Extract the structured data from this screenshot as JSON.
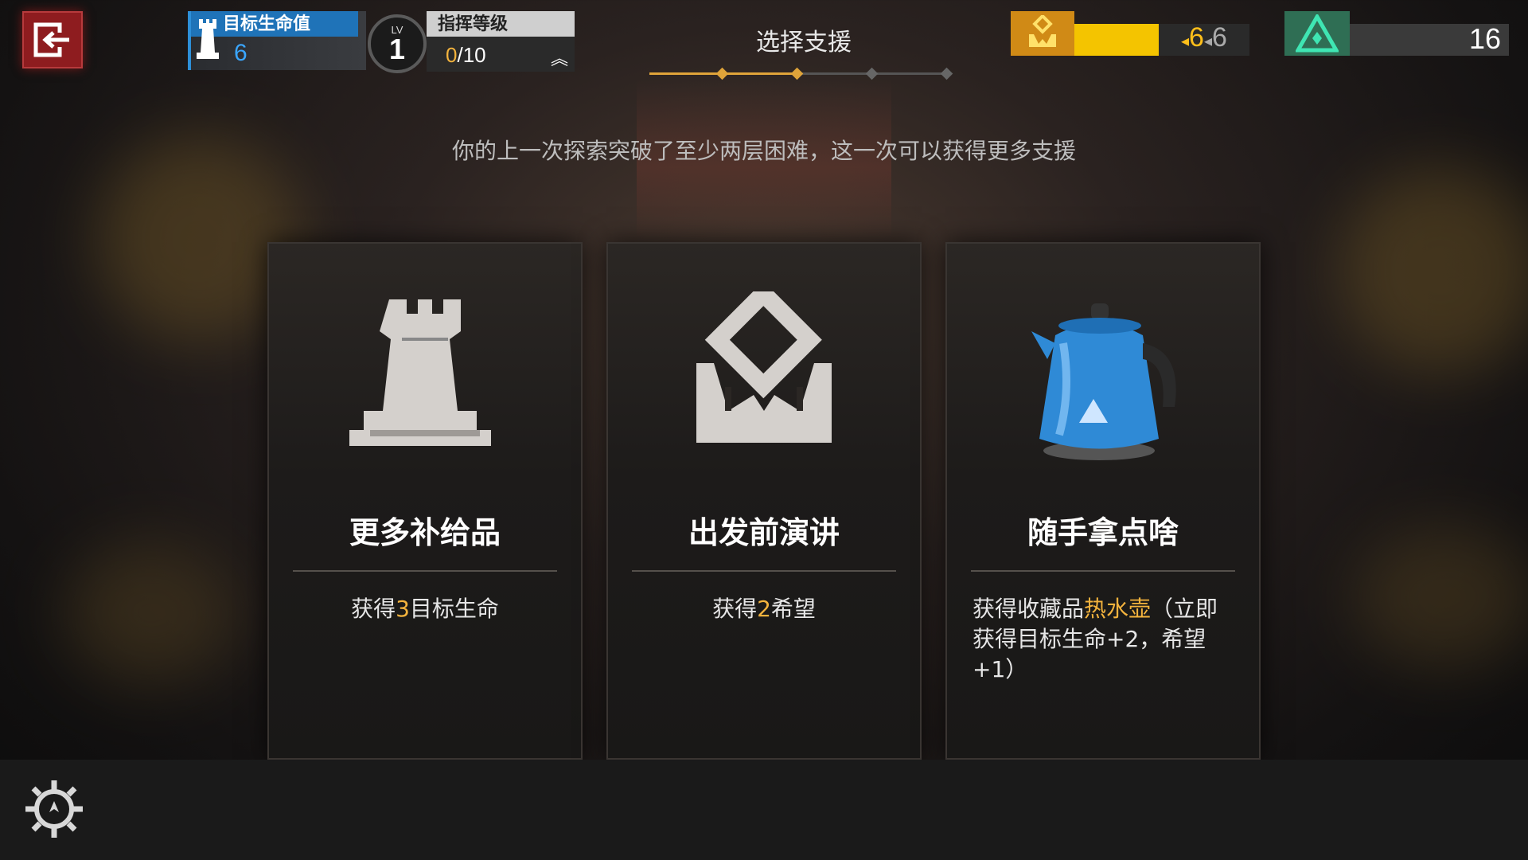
{
  "header": {
    "target_life_label": "目标生命值",
    "target_life_value": "6",
    "level_prefix": "LV",
    "level_value": "1",
    "command_label": "指挥等级",
    "command_progress_current": "0",
    "command_progress_max": "/10",
    "step_title": "选择支援",
    "steps_total": 4,
    "steps_done": 2,
    "hope_value": "6",
    "hope_max": "6",
    "hope_fill_fraction": 0.48,
    "token_value": "16"
  },
  "notice": "你的上一次探索突破了至少两层困难，这一次可以获得更多支援",
  "cards": [
    {
      "title": "更多补给品",
      "desc_prefix": "获得",
      "desc_highlight": "3",
      "desc_suffix": "目标生命",
      "icon": "rook-icon"
    },
    {
      "title": "出发前演讲",
      "desc_prefix": "获得",
      "desc_highlight": "2",
      "desc_suffix": "希望",
      "icon": "hope-hands-icon"
    },
    {
      "title": "随手拿点啥",
      "desc_prefix": "获得收藏品",
      "desc_highlight": "热水壶",
      "desc_suffix": "（立即获得目标生命+2，希望+1）",
      "icon": "kettle-icon"
    }
  ],
  "colors": {
    "accent_gold": "#f3b33d",
    "life_blue": "#3aa6ff",
    "exit_red": "#8e1c1f",
    "hope_yellow": "#f4c400",
    "token_green": "#2f6e54"
  }
}
